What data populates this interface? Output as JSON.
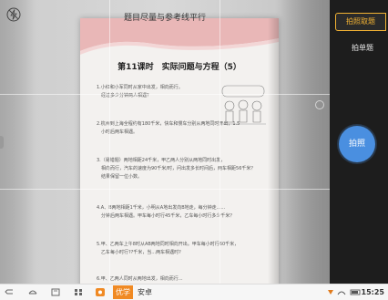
{
  "viewfinder": {
    "instruction": "题目尽量与参考线平行",
    "lesson_title": "第11课时　实际问题与方程（5）",
    "problems": [
      "1.小红和小军同时从家中出发，相向而行。\n　经过多少分钟两人相遇？",
      "2.杭州到上海全程约有180千米，快车和慢车分别从两地同时开出，1.5\n　小时后两车相遇。",
      "3.（易错题）两地相距24千米，甲乙两人分别从两地同时出发，\n　相向而行，汽车的速度为90千米/时，问出发多长时间后，两车相距56千米？\n　结果保留一位小数。",
      "4.A、B两地相距1千米，小明从A地出发向B地走，每分钟走......\n　分钟后两车相遇。甲车每小时行45千米，乙车每小时行多少千米？",
      "5.甲、乙两车上午8时从AB两地同时相向开出。甲车每小时行60千米，\n　乙车每小时行??千米，当...两车相遇时?",
      "6.甲、乙两人同时从两地出发，相向而行..."
    ]
  },
  "right_panel": {
    "mode_active": "拍照取题",
    "mode_other": "拍单题",
    "shutter_label": "拍照"
  },
  "taskbar": {
    "ime_label": "优学",
    "lang_label": "安卓",
    "time": "15:25"
  },
  "colors": {
    "accent": "#f2b233",
    "shutter": "#4a8fe0",
    "ime": "#f08a24",
    "panel": "#1d1d1d"
  }
}
